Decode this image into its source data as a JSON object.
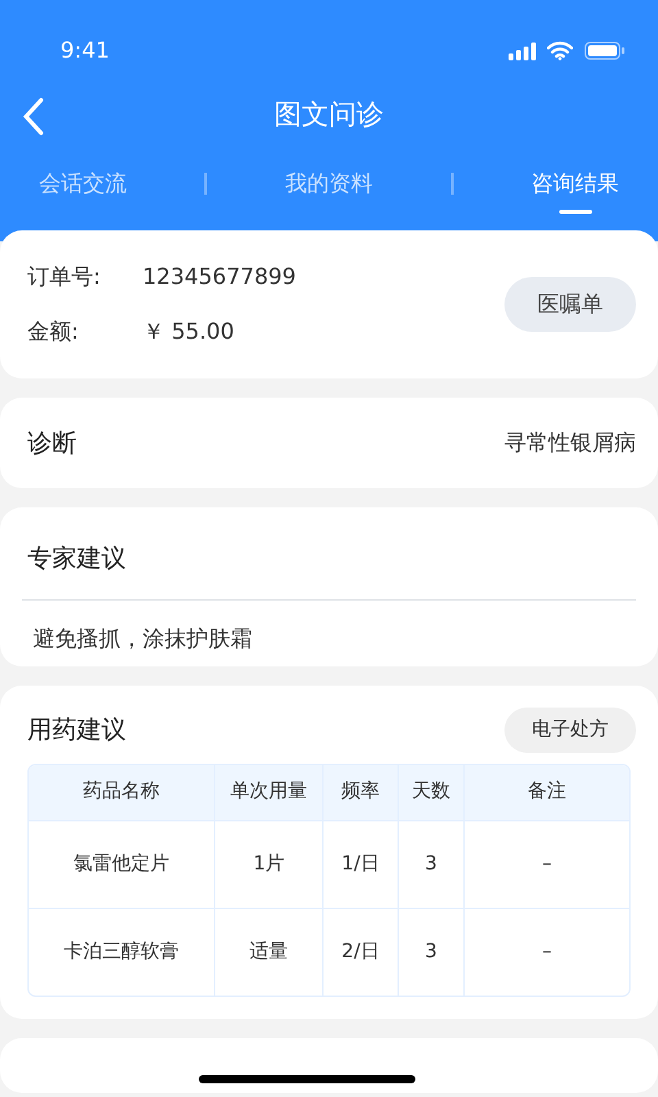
{
  "status_bar": {
    "time": "9:41"
  },
  "header": {
    "title": "图文问诊"
  },
  "tabs": [
    {
      "label": "会话交流",
      "selected": false
    },
    {
      "label": "我的资料",
      "selected": false
    },
    {
      "label": "咨询结果",
      "selected": true
    }
  ],
  "order": {
    "fields": [
      {
        "label": "订单号:",
        "value": "12345677899"
      },
      {
        "label": "金额:",
        "value": "￥ 55.00"
      }
    ],
    "button": "医嘱单"
  },
  "diagnosis": {
    "label": "诊断",
    "value": "寻常性银屑病"
  },
  "expert_advice": {
    "title": "专家建议",
    "text": "避免搔抓，涂抹护肤霜"
  },
  "medication": {
    "title": "用药建议",
    "button": "电子处方",
    "table": {
      "columns": [
        "药品名称",
        "单次用量",
        "频率",
        "天数",
        "备注"
      ],
      "rows": [
        [
          "氯雷他定片",
          "1片",
          "1/日",
          "3",
          "–"
        ],
        [
          "卡泊三醇软膏",
          "适量",
          "2/日",
          "3",
          "–"
        ]
      ]
    }
  }
}
